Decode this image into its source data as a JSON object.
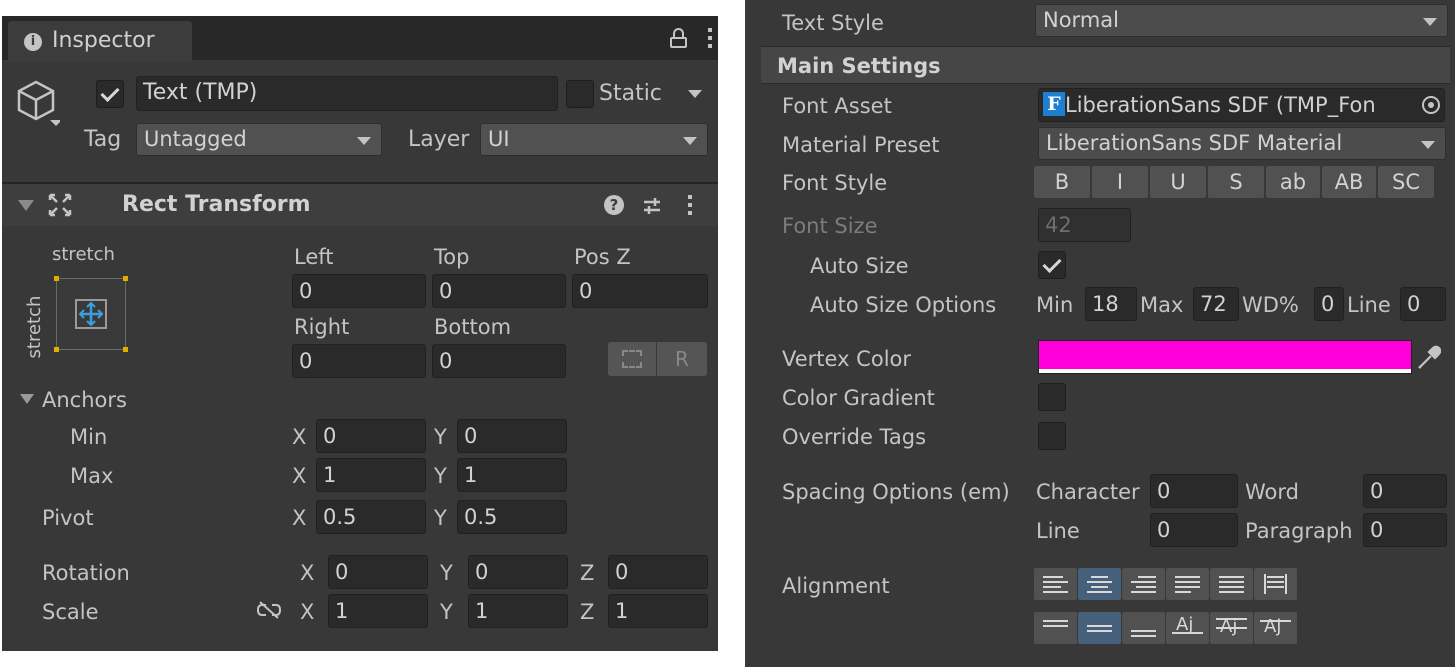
{
  "inspector": {
    "tab_title": "Inspector",
    "object_name": "Text (TMP)",
    "static_label": "Static",
    "tag_label": "Tag",
    "tag_value": "Untagged",
    "layer_label": "Layer",
    "layer_value": "UI"
  },
  "rect_transform": {
    "title": "Rect Transform",
    "anchor_preset_top": "stretch",
    "anchor_preset_side": "stretch",
    "left_label": "Left",
    "left_value": "0",
    "top_label": "Top",
    "top_value": "0",
    "posz_label": "Pos Z",
    "posz_value": "0",
    "right_label": "Right",
    "right_value": "0",
    "bottom_label": "Bottom",
    "bottom_value": "0",
    "r_button": "R",
    "anchors_label": "Anchors",
    "min_label": "Min",
    "min_x": "0",
    "min_y": "0",
    "max_label": "Max",
    "max_x": "1",
    "max_y": "1",
    "pivot_label": "Pivot",
    "pivot_x": "0.5",
    "pivot_y": "0.5",
    "rotation_label": "Rotation",
    "rot_x": "0",
    "rot_y": "0",
    "rot_z": "0",
    "scale_label": "Scale",
    "scale_x": "1",
    "scale_y": "1",
    "scale_z": "1",
    "axis_x": "X",
    "axis_y": "Y",
    "axis_z": "Z"
  },
  "tmp": {
    "text_style_label": "Text Style",
    "text_style_value": "Normal",
    "main_settings": "Main Settings",
    "font_asset_label": "Font Asset",
    "font_asset_value": "LiberationSans SDF (TMP_Fon",
    "font_asset_icon": "F",
    "material_preset_label": "Material Preset",
    "material_preset_value": "LiberationSans SDF Material",
    "font_style_label": "Font Style",
    "font_style_buttons": [
      "B",
      "I",
      "U",
      "S",
      "ab",
      "AB",
      "SC"
    ],
    "font_size_label": "Font Size",
    "font_size_value": "42",
    "auto_size_label": "Auto Size",
    "auto_size_options_label": "Auto Size Options",
    "min_label": "Min",
    "min_value": "18",
    "max_label": "Max",
    "max_value": "72",
    "wd_label": "WD%",
    "wd_value": "0",
    "line_label": "Line",
    "line_value": "0",
    "vertex_color_label": "Vertex Color",
    "vertex_color": "#ff00dc",
    "color_gradient_label": "Color Gradient",
    "override_tags_label": "Override Tags",
    "spacing_label": "Spacing Options (em)",
    "character_label": "Character",
    "character_value": "0",
    "word_label": "Word",
    "word_value": "0",
    "sp_line_label": "Line",
    "sp_line_value": "0",
    "paragraph_label": "Paragraph",
    "paragraph_value": "0",
    "alignment_label": "Alignment"
  }
}
